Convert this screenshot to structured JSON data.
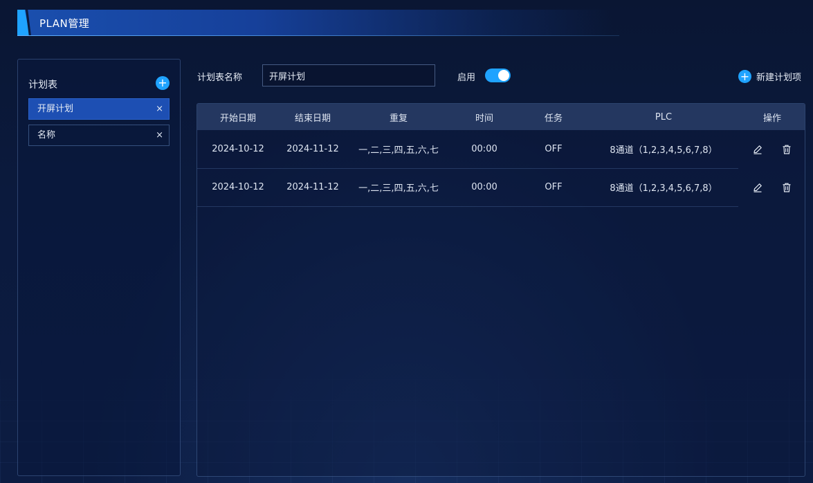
{
  "header": {
    "title": "PLAN管理"
  },
  "sidebar": {
    "title": "计划表",
    "add_icon": "plus-icon",
    "items": [
      {
        "label": "开屏计划",
        "active": true
      },
      {
        "label": "名称",
        "active": false
      }
    ],
    "remove_glyph": "×"
  },
  "controls": {
    "name_label": "计划表名称",
    "name_value": "开屏计划",
    "enable_label": "启用",
    "enabled": true,
    "new_item_label": "新建计划项"
  },
  "table": {
    "columns": [
      "开始日期",
      "结束日期",
      "重复",
      "时间",
      "任务",
      "PLC",
      "操作"
    ],
    "rows": [
      {
        "start": "2024-10-12",
        "end": "2024-11-12",
        "repeat": "一,二,三,四,五,六,七",
        "time": "00:00",
        "task": "OFF",
        "plc": "8通道（1,2,3,4,5,6,7,8）"
      },
      {
        "start": "2024-10-12",
        "end": "2024-11-12",
        "repeat": "一,二,三,四,五,六,七",
        "time": "00:00",
        "task": "OFF",
        "plc": "8通道（1,2,3,4,5,6,7,8）"
      }
    ],
    "row_icons": [
      "edit-icon",
      "trash-icon"
    ]
  },
  "colors": {
    "accent": "#1fa3ff",
    "active_item": "#1d4fb3",
    "background": "#0b1a3d"
  }
}
